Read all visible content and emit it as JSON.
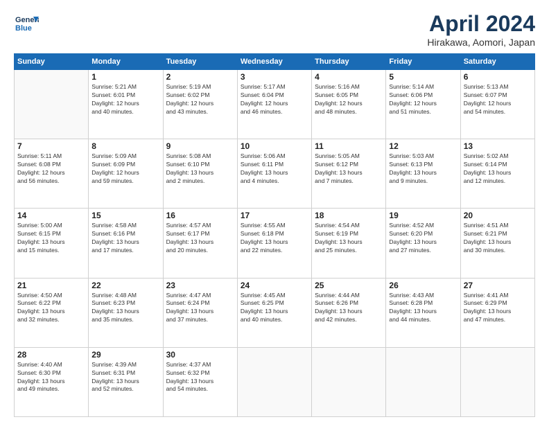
{
  "header": {
    "logo_general": "General",
    "logo_blue": "Blue",
    "title": "April 2024",
    "subtitle": "Hirakawa, Aomori, Japan"
  },
  "days_of_week": [
    "Sunday",
    "Monday",
    "Tuesday",
    "Wednesday",
    "Thursday",
    "Friday",
    "Saturday"
  ],
  "weeks": [
    [
      {
        "day": "",
        "info": ""
      },
      {
        "day": "1",
        "info": "Sunrise: 5:21 AM\nSunset: 6:01 PM\nDaylight: 12 hours\nand 40 minutes."
      },
      {
        "day": "2",
        "info": "Sunrise: 5:19 AM\nSunset: 6:02 PM\nDaylight: 12 hours\nand 43 minutes."
      },
      {
        "day": "3",
        "info": "Sunrise: 5:17 AM\nSunset: 6:04 PM\nDaylight: 12 hours\nand 46 minutes."
      },
      {
        "day": "4",
        "info": "Sunrise: 5:16 AM\nSunset: 6:05 PM\nDaylight: 12 hours\nand 48 minutes."
      },
      {
        "day": "5",
        "info": "Sunrise: 5:14 AM\nSunset: 6:06 PM\nDaylight: 12 hours\nand 51 minutes."
      },
      {
        "day": "6",
        "info": "Sunrise: 5:13 AM\nSunset: 6:07 PM\nDaylight: 12 hours\nand 54 minutes."
      }
    ],
    [
      {
        "day": "7",
        "info": "Sunrise: 5:11 AM\nSunset: 6:08 PM\nDaylight: 12 hours\nand 56 minutes."
      },
      {
        "day": "8",
        "info": "Sunrise: 5:09 AM\nSunset: 6:09 PM\nDaylight: 12 hours\nand 59 minutes."
      },
      {
        "day": "9",
        "info": "Sunrise: 5:08 AM\nSunset: 6:10 PM\nDaylight: 13 hours\nand 2 minutes."
      },
      {
        "day": "10",
        "info": "Sunrise: 5:06 AM\nSunset: 6:11 PM\nDaylight: 13 hours\nand 4 minutes."
      },
      {
        "day": "11",
        "info": "Sunrise: 5:05 AM\nSunset: 6:12 PM\nDaylight: 13 hours\nand 7 minutes."
      },
      {
        "day": "12",
        "info": "Sunrise: 5:03 AM\nSunset: 6:13 PM\nDaylight: 13 hours\nand 9 minutes."
      },
      {
        "day": "13",
        "info": "Sunrise: 5:02 AM\nSunset: 6:14 PM\nDaylight: 13 hours\nand 12 minutes."
      }
    ],
    [
      {
        "day": "14",
        "info": "Sunrise: 5:00 AM\nSunset: 6:15 PM\nDaylight: 13 hours\nand 15 minutes."
      },
      {
        "day": "15",
        "info": "Sunrise: 4:58 AM\nSunset: 6:16 PM\nDaylight: 13 hours\nand 17 minutes."
      },
      {
        "day": "16",
        "info": "Sunrise: 4:57 AM\nSunset: 6:17 PM\nDaylight: 13 hours\nand 20 minutes."
      },
      {
        "day": "17",
        "info": "Sunrise: 4:55 AM\nSunset: 6:18 PM\nDaylight: 13 hours\nand 22 minutes."
      },
      {
        "day": "18",
        "info": "Sunrise: 4:54 AM\nSunset: 6:19 PM\nDaylight: 13 hours\nand 25 minutes."
      },
      {
        "day": "19",
        "info": "Sunrise: 4:52 AM\nSunset: 6:20 PM\nDaylight: 13 hours\nand 27 minutes."
      },
      {
        "day": "20",
        "info": "Sunrise: 4:51 AM\nSunset: 6:21 PM\nDaylight: 13 hours\nand 30 minutes."
      }
    ],
    [
      {
        "day": "21",
        "info": "Sunrise: 4:50 AM\nSunset: 6:22 PM\nDaylight: 13 hours\nand 32 minutes."
      },
      {
        "day": "22",
        "info": "Sunrise: 4:48 AM\nSunset: 6:23 PM\nDaylight: 13 hours\nand 35 minutes."
      },
      {
        "day": "23",
        "info": "Sunrise: 4:47 AM\nSunset: 6:24 PM\nDaylight: 13 hours\nand 37 minutes."
      },
      {
        "day": "24",
        "info": "Sunrise: 4:45 AM\nSunset: 6:25 PM\nDaylight: 13 hours\nand 40 minutes."
      },
      {
        "day": "25",
        "info": "Sunrise: 4:44 AM\nSunset: 6:26 PM\nDaylight: 13 hours\nand 42 minutes."
      },
      {
        "day": "26",
        "info": "Sunrise: 4:43 AM\nSunset: 6:28 PM\nDaylight: 13 hours\nand 44 minutes."
      },
      {
        "day": "27",
        "info": "Sunrise: 4:41 AM\nSunset: 6:29 PM\nDaylight: 13 hours\nand 47 minutes."
      }
    ],
    [
      {
        "day": "28",
        "info": "Sunrise: 4:40 AM\nSunset: 6:30 PM\nDaylight: 13 hours\nand 49 minutes."
      },
      {
        "day": "29",
        "info": "Sunrise: 4:39 AM\nSunset: 6:31 PM\nDaylight: 13 hours\nand 52 minutes."
      },
      {
        "day": "30",
        "info": "Sunrise: 4:37 AM\nSunset: 6:32 PM\nDaylight: 13 hours\nand 54 minutes."
      },
      {
        "day": "",
        "info": ""
      },
      {
        "day": "",
        "info": ""
      },
      {
        "day": "",
        "info": ""
      },
      {
        "day": "",
        "info": ""
      }
    ]
  ]
}
